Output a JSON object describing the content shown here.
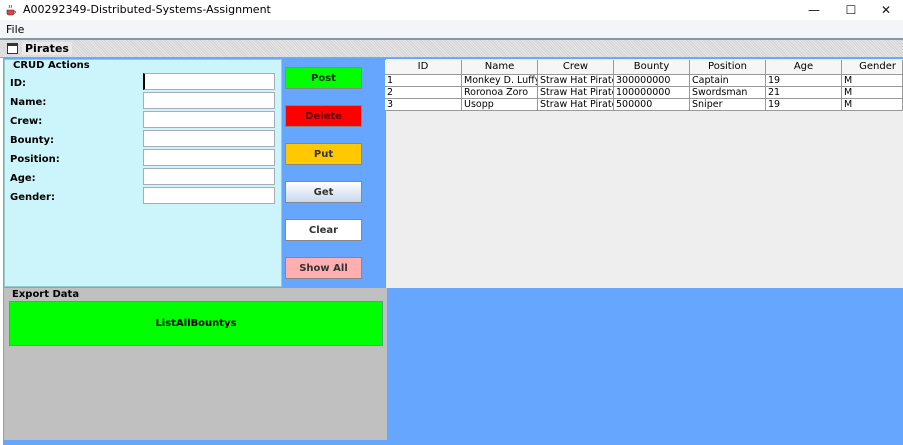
{
  "window": {
    "title": "A00292349-Distributed-Systems-Assignment",
    "minimize_glyph": "—",
    "maximize_glyph": "☐",
    "close_glyph": "✕",
    "icon": "java-cup-icon"
  },
  "menu": {
    "file_label": "File"
  },
  "internal_frame": {
    "title": "Pirates",
    "icon": "frame-icon"
  },
  "crud": {
    "legend": "CRUD Actions",
    "fields": [
      {
        "label": "ID:",
        "value": ""
      },
      {
        "label": "Name:",
        "value": ""
      },
      {
        "label": "Crew:",
        "value": ""
      },
      {
        "label": "Bounty:",
        "value": ""
      },
      {
        "label": "Position:",
        "value": ""
      },
      {
        "label": "Age:",
        "value": ""
      },
      {
        "label": "Gender:",
        "value": ""
      }
    ]
  },
  "buttons": {
    "post": "Post",
    "delete": "Delete",
    "put": "Put",
    "get": "Get",
    "clear": "Clear",
    "show_all": "Show All"
  },
  "button_colors": {
    "post": "#00ff00",
    "delete": "#ff0000",
    "put": "#ffc800",
    "clear": "#ffffff",
    "show_all": "#ffafaf",
    "list_all": "#00ff00"
  },
  "table": {
    "columns": [
      "ID",
      "Name",
      "Crew",
      "Bounty",
      "Position",
      "Age",
      "Gender"
    ],
    "rows": [
      [
        "1",
        "Monkey D. Luffy",
        "Straw Hat Pirates",
        "300000000",
        "Captain",
        "19",
        "M"
      ],
      [
        "2",
        "Roronoa Zoro",
        "Straw Hat Pirates",
        "100000000",
        "Swordsman",
        "21",
        "M"
      ],
      [
        "3",
        "Usopp",
        "Straw Hat Pirates",
        "500000",
        "Sniper",
        "19",
        "M"
      ]
    ]
  },
  "export": {
    "legend": "Export Data",
    "list_button": "ListAllBountys"
  },
  "colors": {
    "content_bg": "#66a6ff",
    "crud_bg": "#ccf5fb",
    "export_bg": "#c0c0c0",
    "table_bg": "#eeeeee"
  }
}
